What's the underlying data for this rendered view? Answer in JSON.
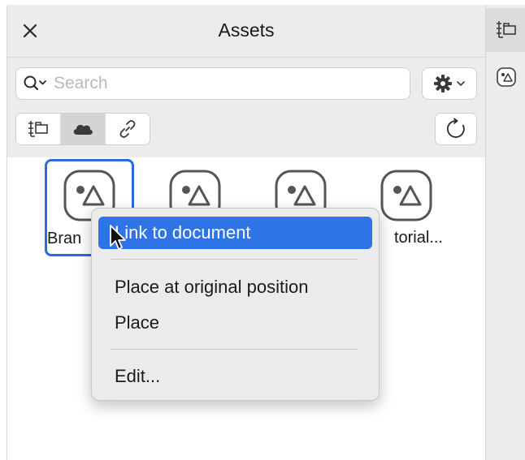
{
  "panel": {
    "title": "Assets",
    "close_icon": "close-icon"
  },
  "search": {
    "placeholder": "Search",
    "value": "",
    "icon": "search-icon"
  },
  "toolbar": {
    "settings_icon": "gear-icon",
    "source_tabs": [
      {
        "icon": "document-tree-icon",
        "active": false
      },
      {
        "icon": "cloud-icon",
        "active": true
      },
      {
        "icon": "link-icon",
        "active": false
      }
    ],
    "refresh_icon": "refresh-icon"
  },
  "assets": [
    {
      "label": "Bran",
      "selected": true
    },
    {
      "label": "",
      "selected": false
    },
    {
      "label": "",
      "selected": false
    },
    {
      "label": "torial...",
      "selected": false
    }
  ],
  "context_menu": {
    "items": [
      {
        "label": "Link to document",
        "highlighted": true
      },
      {
        "label": "Place at original position",
        "highlighted": false
      },
      {
        "label": "Place",
        "highlighted": false
      },
      {
        "label": "Edit...",
        "highlighted": false
      }
    ]
  },
  "side_strip": {
    "tabs": [
      {
        "icon": "document-tree-icon",
        "active": true
      },
      {
        "icon": "assets-icon",
        "active": false
      }
    ]
  },
  "colors": {
    "accent": "#2f74e6",
    "selection_border": "#2d6ae0",
    "panel_bg": "#ececec"
  }
}
